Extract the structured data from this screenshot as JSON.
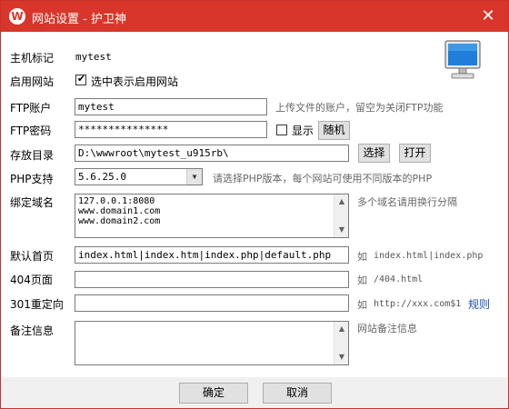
{
  "window": {
    "title": "网站设置 - 护卫神",
    "logo_letter": "W",
    "close_glyph": "✕"
  },
  "host": {
    "label": "主机标记",
    "value": "mytest"
  },
  "enable": {
    "label": "启用网站",
    "checkbox_label": "选中表示启用网站",
    "checked": true
  },
  "ftp_account": {
    "label": "FTP账户",
    "value": "mytest",
    "hint": "上传文件的账户，留空为关闭FTP功能"
  },
  "ftp_password": {
    "label": "FTP密码",
    "value": "***************",
    "show_label": "显示",
    "show_checked": false,
    "random_button": "随机"
  },
  "directory": {
    "label": "存放目录",
    "value": "D:\\wwwroot\\mytest_u915rb\\",
    "select_button": "选择",
    "open_button": "打开"
  },
  "php": {
    "label": "PHP支持",
    "value": "5.6.25.0",
    "hint": "请选择PHP版本，每个网站可使用不同版本的PHP"
  },
  "domains": {
    "label": "绑定域名",
    "value": "127.0.0.1:8080\nwww.domain1.com\nwww.domain2.com",
    "hint": "多个域名请用换行分隔"
  },
  "default_page": {
    "label": "默认首页",
    "value": "index.html|index.htm|index.php|default.php",
    "hint_prefix": "如",
    "hint_example": "index.html|index.php"
  },
  "page404": {
    "label": "404页面",
    "value": "",
    "hint_prefix": "如",
    "hint_example": "/404.html"
  },
  "redirect301": {
    "label": "301重定向",
    "value": "",
    "hint_prefix": "如",
    "hint_example": "http://xxx.com$1",
    "rules_link": "规则"
  },
  "notes": {
    "label": "备注信息",
    "value": "",
    "hint": "网站备注信息"
  },
  "footer": {
    "ok": "确定",
    "cancel": "取消"
  },
  "colors": {
    "titlebar": "#d9362b",
    "link": "#1a4fb5"
  },
  "icons": {
    "monitor": "monitor-icon",
    "up": "▲",
    "down": "▼",
    "dropdown": "▼",
    "tick": "✔"
  }
}
